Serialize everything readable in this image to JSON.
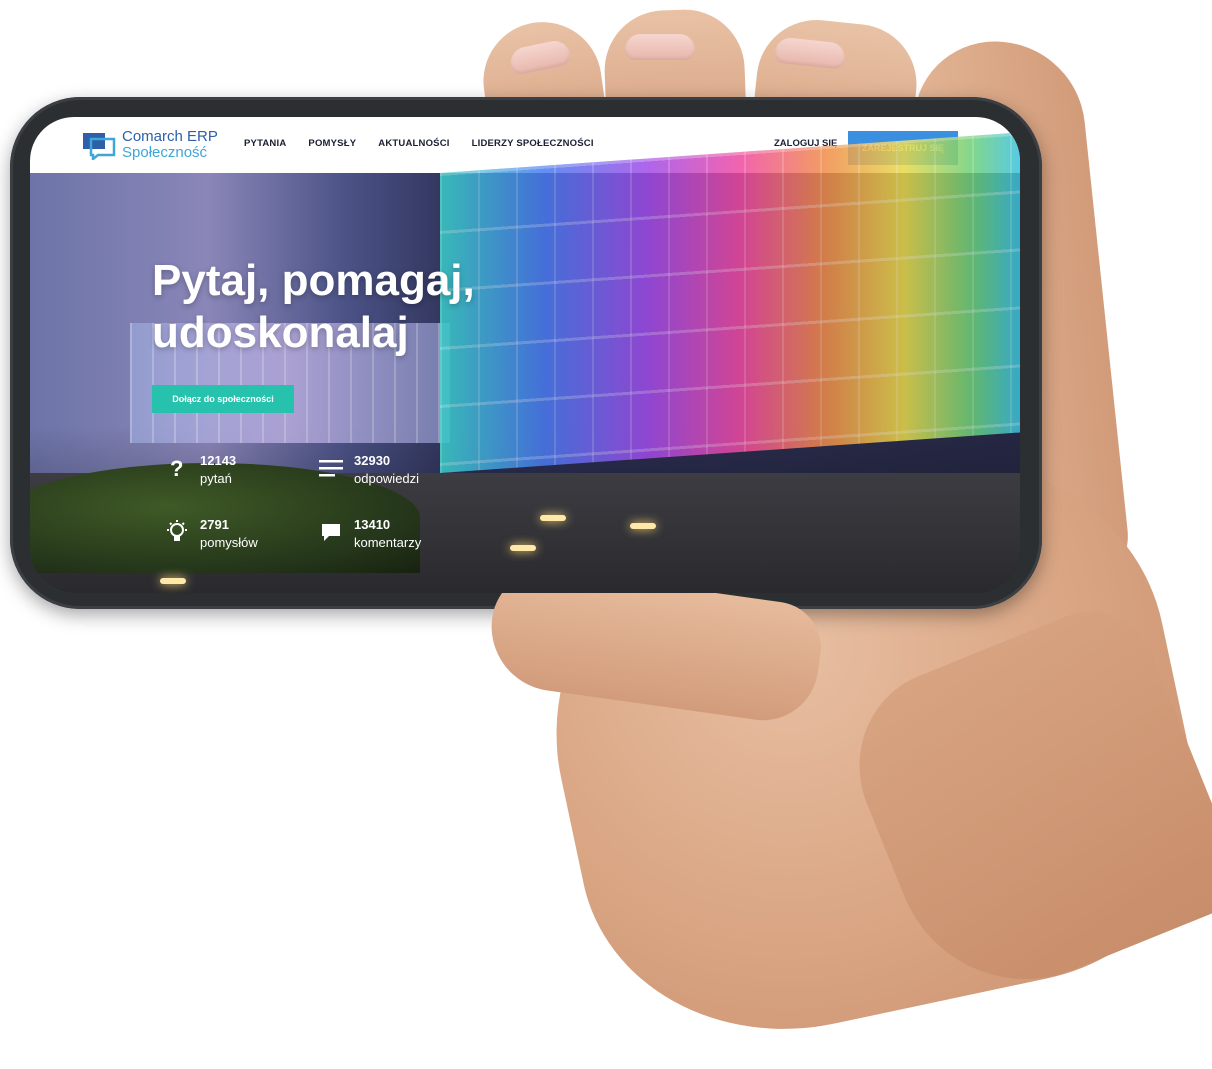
{
  "brand": {
    "line1": "Comarch ERP",
    "line2": "Społeczność"
  },
  "nav": {
    "items": [
      {
        "label": "PYTANIA"
      },
      {
        "label": "POMYSŁY"
      },
      {
        "label": "AKTUALNOŚCI"
      },
      {
        "label": "LIDERZY SPOŁECZNOŚCI"
      }
    ],
    "login_label": "ZALOGUJ SIĘ",
    "register_label": "ZAREJESTRUJ SIĘ"
  },
  "hero": {
    "title_line1": "Pytaj, pomagaj,",
    "title_line2": "udoskonalaj",
    "cta_label": "Dołącz do społeczności"
  },
  "stats": [
    {
      "number": "12143",
      "label": "pytań",
      "icon": "question-icon"
    },
    {
      "number": "32930",
      "label": "odpowiedzi",
      "icon": "lines-icon"
    },
    {
      "number": "2791",
      "label": "pomysłów",
      "icon": "lightbulb-icon"
    },
    {
      "number": "13410",
      "label": "komentarzy",
      "icon": "comment-icon"
    }
  ],
  "colors": {
    "accent": "#3b8fe0",
    "cta": "#27c2ad",
    "brand_blue": "#2e5fa8",
    "brand_light": "#3fa6d8"
  }
}
